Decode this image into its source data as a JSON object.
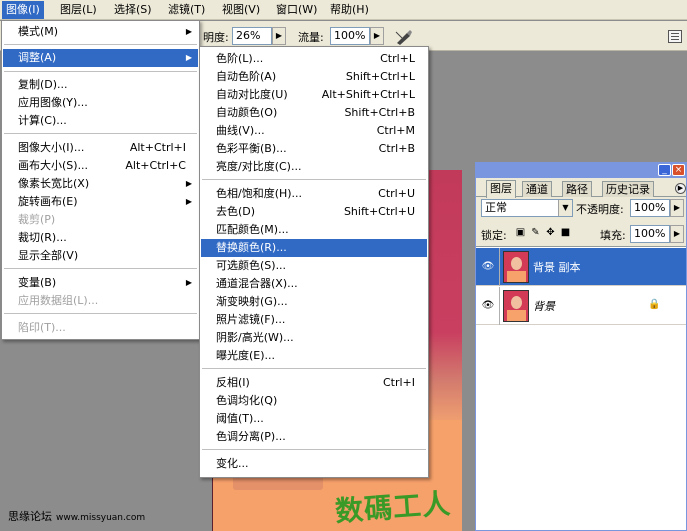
{
  "menubar": {
    "items": [
      {
        "label": "图像(I)"
      },
      {
        "label": "图层(L)"
      },
      {
        "label": "选择(S)"
      },
      {
        "label": "滤镜(T)"
      },
      {
        "label": "视图(V)"
      },
      {
        "label": "窗口(W)"
      },
      {
        "label": "帮助(H)"
      }
    ]
  },
  "options_bar": {
    "opacity_label": "明度:",
    "opacity_value": "26%",
    "flow_label": "流量:",
    "flow_value": "100%"
  },
  "image_menu": {
    "items": [
      {
        "label": "模式(M)",
        "shortcut": ""
      },
      {
        "label": "调整(A)",
        "shortcut": ""
      },
      {
        "label": "复制(D)...",
        "shortcut": ""
      },
      {
        "label": "应用图像(Y)...",
        "shortcut": ""
      },
      {
        "label": "计算(C)...",
        "shortcut": ""
      },
      {
        "label": "图像大小(I)...",
        "shortcut": "Alt+Ctrl+I"
      },
      {
        "label": "画布大小(S)...",
        "shortcut": "Alt+Ctrl+C"
      },
      {
        "label": "像素长宽比(X)",
        "shortcut": ""
      },
      {
        "label": "旋转画布(E)",
        "shortcut": ""
      },
      {
        "label": "裁剪(P)",
        "shortcut": ""
      },
      {
        "label": "裁切(R)...",
        "shortcut": ""
      },
      {
        "label": "显示全部(V)",
        "shortcut": ""
      },
      {
        "label": "变量(B)",
        "shortcut": ""
      },
      {
        "label": "应用数据组(L)...",
        "shortcut": ""
      },
      {
        "label": "陷印(T)...",
        "shortcut": ""
      }
    ]
  },
  "adjust_menu": {
    "items": [
      {
        "label": "色阶(L)...",
        "shortcut": "Ctrl+L"
      },
      {
        "label": "自动色阶(A)",
        "shortcut": "Shift+Ctrl+L"
      },
      {
        "label": "自动对比度(U)",
        "shortcut": "Alt+Shift+Ctrl+L"
      },
      {
        "label": "自动颜色(O)",
        "shortcut": "Shift+Ctrl+B"
      },
      {
        "label": "曲线(V)...",
        "shortcut": "Ctrl+M"
      },
      {
        "label": "色彩平衡(B)...",
        "shortcut": "Ctrl+B"
      },
      {
        "label": "亮度/对比度(C)...",
        "shortcut": ""
      },
      {
        "label": "色相/饱和度(H)...",
        "shortcut": "Ctrl+U"
      },
      {
        "label": "去色(D)",
        "shortcut": "Shift+Ctrl+U"
      },
      {
        "label": "匹配颜色(M)...",
        "shortcut": ""
      },
      {
        "label": "替换颜色(R)...",
        "shortcut": ""
      },
      {
        "label": "可选颜色(S)...",
        "shortcut": ""
      },
      {
        "label": "通道混合器(X)...",
        "shortcut": ""
      },
      {
        "label": "渐变映射(G)...",
        "shortcut": ""
      },
      {
        "label": "照片滤镜(F)...",
        "shortcut": ""
      },
      {
        "label": "阴影/高光(W)...",
        "shortcut": ""
      },
      {
        "label": "曝光度(E)...",
        "shortcut": ""
      },
      {
        "label": "反相(I)",
        "shortcut": "Ctrl+I"
      },
      {
        "label": "色调均化(Q)",
        "shortcut": ""
      },
      {
        "label": "阈值(T)...",
        "shortcut": ""
      },
      {
        "label": "色调分离(P)...",
        "shortcut": ""
      },
      {
        "label": "变化...",
        "shortcut": ""
      }
    ]
  },
  "layers_panel": {
    "tabs": [
      {
        "label": "图层"
      },
      {
        "label": "通道"
      },
      {
        "label": "路径"
      },
      {
        "label": "历史记录"
      }
    ],
    "blend_mode": "正常",
    "opacity_label": "不透明度:",
    "opacity_value": "100%",
    "lock_label": "锁定:",
    "fill_label": "填充:",
    "fill_value": "100%",
    "layers": [
      {
        "name": "背景 副本"
      },
      {
        "name": "背景"
      }
    ]
  },
  "canvas": {
    "watermark_text": "数碼工人"
  },
  "footer": {
    "site_name": "思缘论坛",
    "site_url": "www.missyuan.com"
  },
  "colors": {
    "highlight": "#316ac5",
    "menubar": "#ece9d8",
    "panel_title": "#7a96df"
  }
}
